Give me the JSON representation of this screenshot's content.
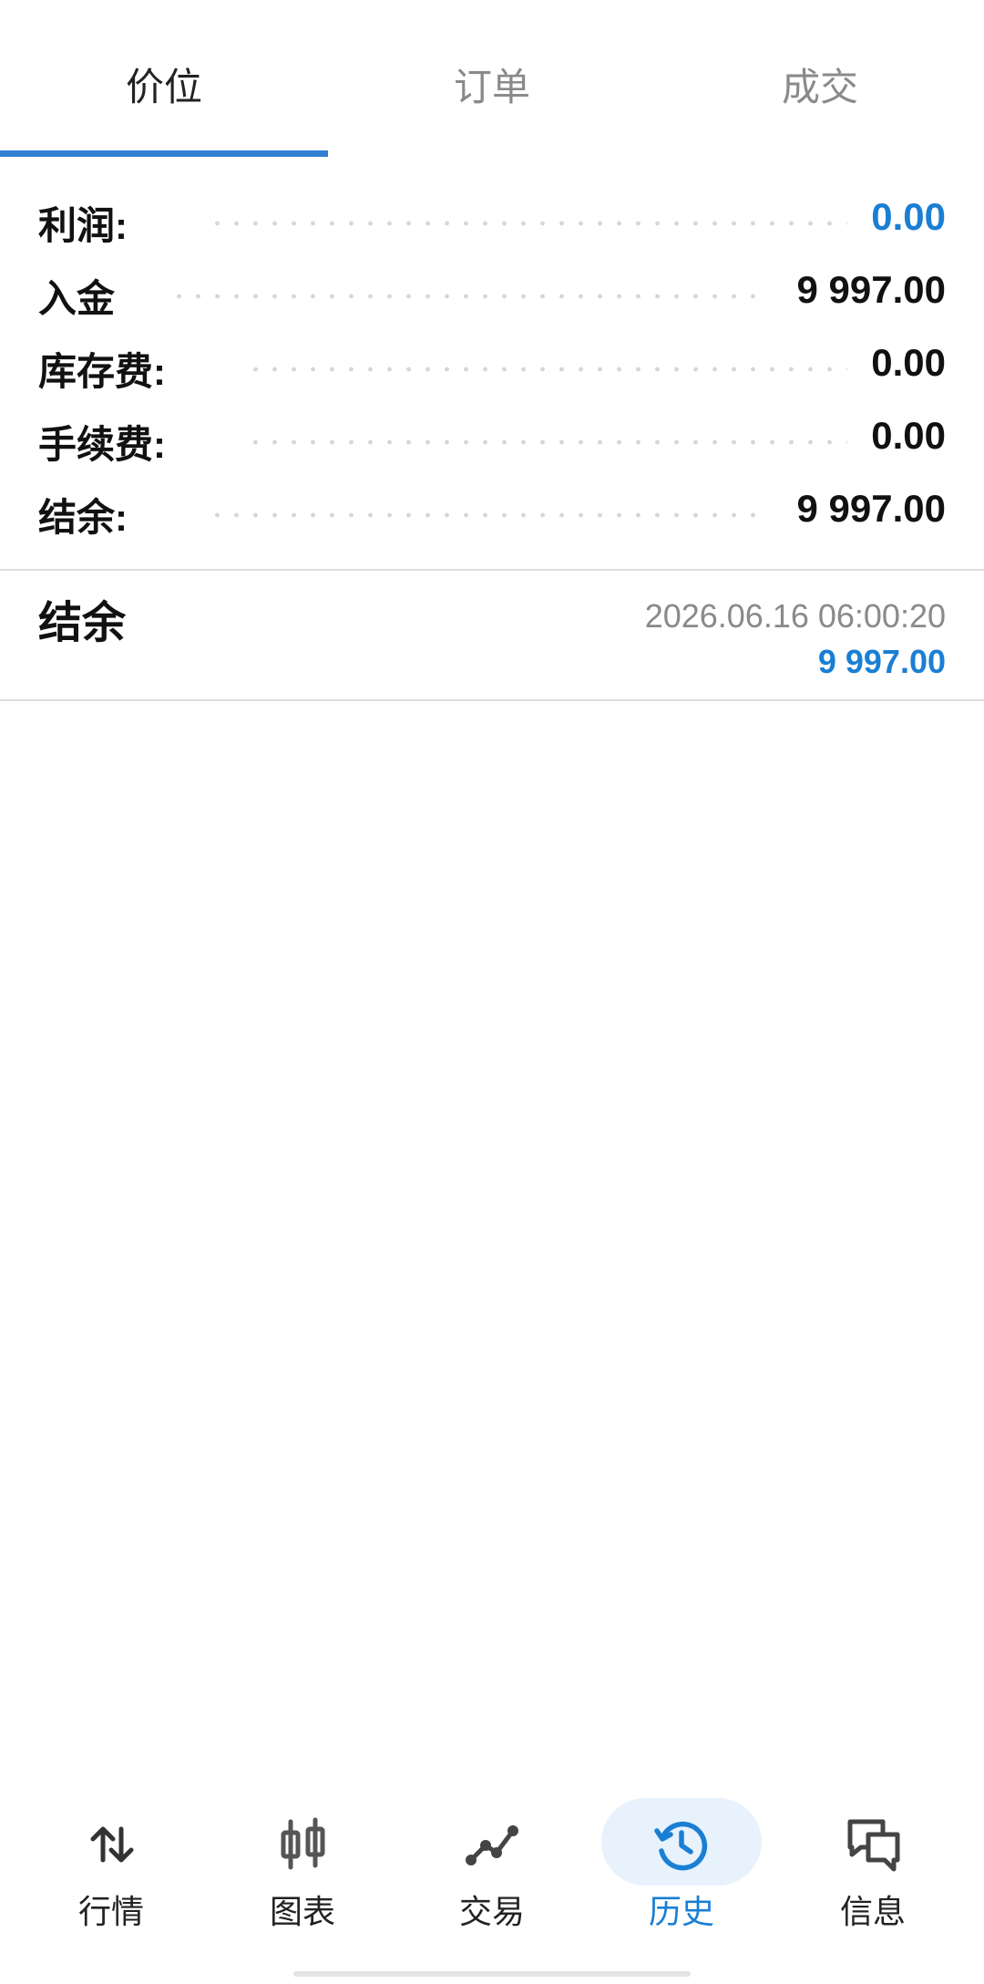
{
  "tabs": [
    {
      "label": "价位",
      "active": true
    },
    {
      "label": "订单",
      "active": false
    },
    {
      "label": "成交",
      "active": false
    }
  ],
  "summary": [
    {
      "label": "利润:",
      "value": "0.00",
      "color": "#1a7fd4"
    },
    {
      "label": "入金",
      "value": "9 997.00",
      "color": "#111111"
    },
    {
      "label": "库存费:",
      "value": "0.00",
      "color": "#111111"
    },
    {
      "label": "手续费:",
      "value": "0.00",
      "color": "#111111"
    },
    {
      "label": "结余:",
      "value": "9 997.00",
      "color": "#111111"
    }
  ],
  "entry": {
    "title": "结余",
    "timestamp": "2026.06.16 06:00:20",
    "amount": "9 997.00"
  },
  "nav": [
    {
      "label": "行情",
      "icon": "up-down-arrows-icon",
      "active": false
    },
    {
      "label": "图表",
      "icon": "candlestick-icon",
      "active": false
    },
    {
      "label": "交易",
      "icon": "trade-line-icon",
      "active": false
    },
    {
      "label": "历史",
      "icon": "history-clock-icon",
      "active": true
    },
    {
      "label": "信息",
      "icon": "chat-bubbles-icon",
      "active": false
    }
  ],
  "colors": {
    "accent": "#1a7fd4",
    "tab_indicator": "#2f7fd3",
    "active_pill": "#e8f2fc"
  }
}
